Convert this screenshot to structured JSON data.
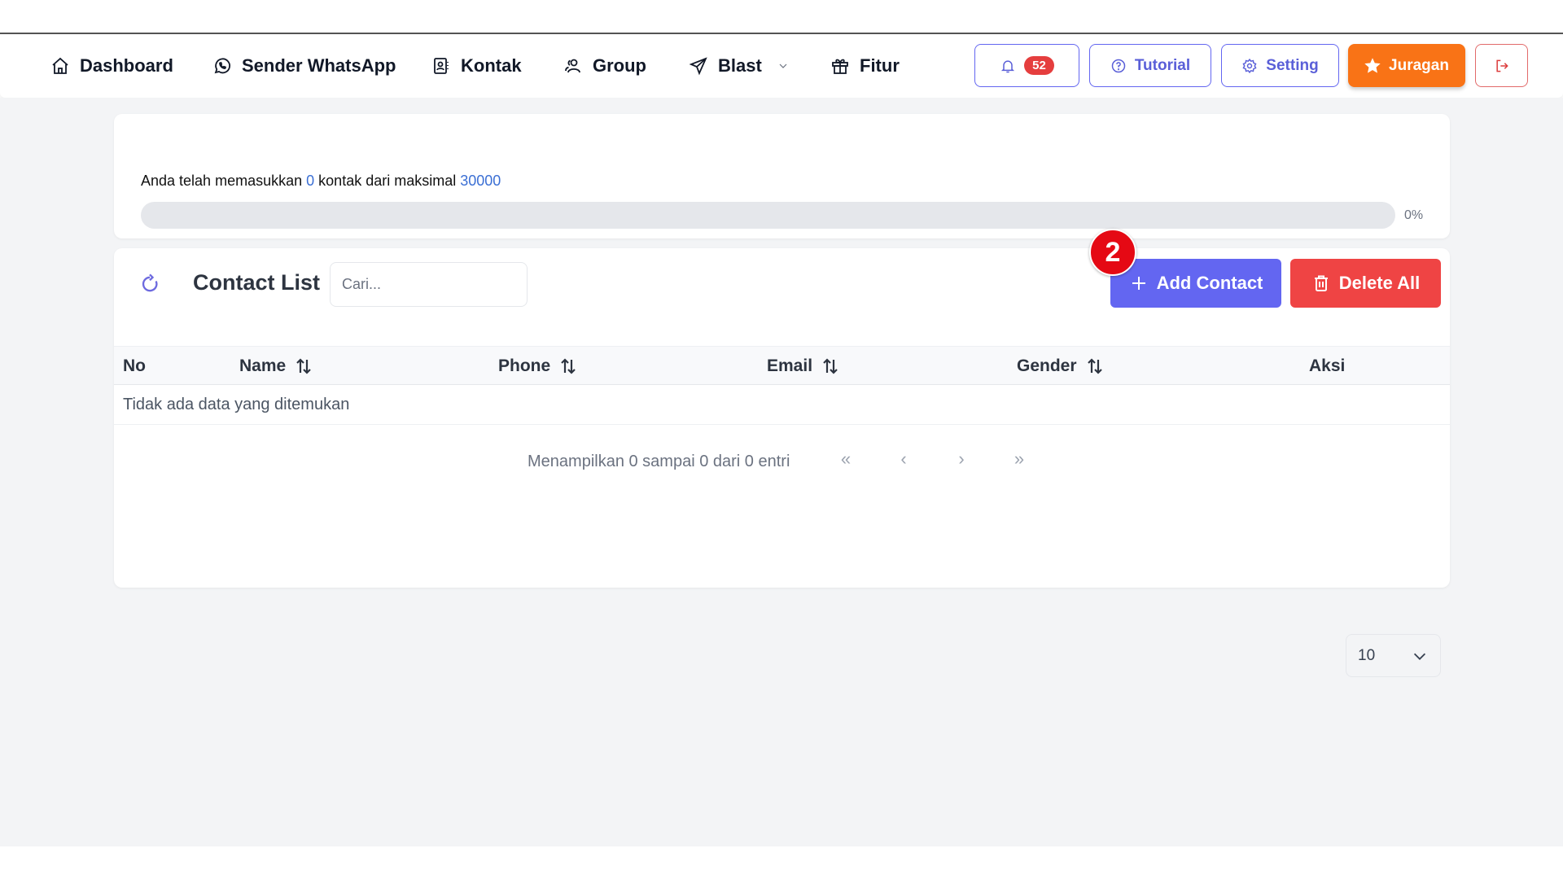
{
  "nav": {
    "items": [
      {
        "label": "Dashboard",
        "icon": "home-icon"
      },
      {
        "label": "Sender WhatsApp",
        "icon": "whatsapp-icon"
      },
      {
        "label": "Kontak",
        "icon": "contact-book-icon"
      },
      {
        "label": "Group",
        "icon": "users-icon"
      },
      {
        "label": "Blast",
        "icon": "send-icon"
      },
      {
        "label": "Fitur",
        "icon": "gift-icon"
      }
    ],
    "notification_count": "52",
    "tutorial_label": "Tutorial",
    "setting_label": "Setting",
    "juragan_label": "Juragan"
  },
  "quota": {
    "text_prefix": "Anda telah memasukkan",
    "current": "0",
    "text_middle": "kontak dari maksimal",
    "max": "30000",
    "percent_label": "0%",
    "progress_fraction": 0
  },
  "contact_list": {
    "title": "Contact List",
    "search_placeholder": "Cari...",
    "search_value": "",
    "add_label": "Add Contact",
    "delete_all_label": "Delete All",
    "step_marker": "2",
    "columns": [
      "No",
      "Name",
      "Phone",
      "Email",
      "Gender",
      "Aksi"
    ],
    "empty_message": "Tidak ada data yang ditemukan",
    "pagination_info": "Menampilkan 0 sampai 0 dari 0 entri",
    "pager": {
      "first": "«",
      "prev": "‹",
      "next": "›",
      "last": "»"
    },
    "per_page": "10"
  }
}
